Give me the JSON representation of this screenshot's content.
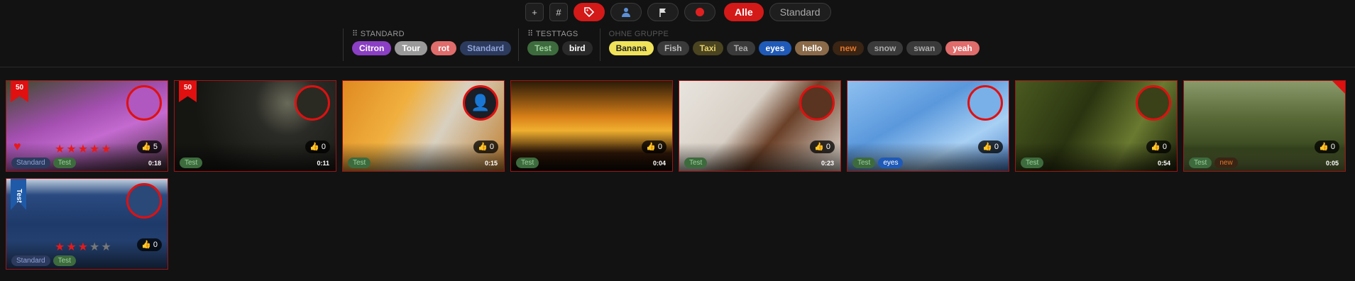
{
  "toolbar": {
    "buttons": [
      {
        "name": "add-button",
        "icon": "+"
      },
      {
        "name": "hash-button",
        "icon": "#"
      },
      {
        "name": "tag-button",
        "icon": "tag-icon",
        "active": true
      },
      {
        "name": "person-button",
        "icon": "person-icon"
      },
      {
        "name": "flag-button",
        "icon": "flag-icon"
      },
      {
        "name": "record-button",
        "icon": "record-icon"
      }
    ],
    "alle_label": "Alle",
    "standard_label": "Standard"
  },
  "filters": {
    "standard": {
      "title": "STANDARD",
      "chips": [
        {
          "label": "Citron",
          "bg": "#8b3fc4",
          "fg": "#fff"
        },
        {
          "label": "Tour",
          "bg": "#9a9a9a",
          "fg": "#fff"
        },
        {
          "label": "rot",
          "bg": "#e06c6c",
          "fg": "#fff"
        },
        {
          "label": "Standard",
          "bg": "#2c3a5e",
          "fg": "#8fa3d6"
        }
      ]
    },
    "testtags": {
      "title": "TESTTAGS",
      "chips": [
        {
          "label": "Test",
          "bg": "#3d6b3d",
          "fg": "#9ecf9e"
        },
        {
          "label": "bird",
          "bg": "#2a2a2a",
          "fg": "#fff"
        }
      ]
    },
    "ohne": {
      "title": "OHNE GRUPPE",
      "chips": [
        {
          "label": "Banana",
          "bg": "#f0e35a",
          "fg": "#222"
        },
        {
          "label": "Fish",
          "bg": "#3a3a3a",
          "fg": "#bbb"
        },
        {
          "label": "Taxi",
          "bg": "#4a4420",
          "fg": "#e8d36a"
        },
        {
          "label": "Tea",
          "bg": "#3a3a3a",
          "fg": "#aaa"
        },
        {
          "label": "eyes",
          "bg": "#1f5ab8",
          "fg": "#fff"
        },
        {
          "label": "hello",
          "bg": "#8a6a48",
          "fg": "#fff"
        },
        {
          "label": "new",
          "bg": "#3a2414",
          "fg": "#e0762a"
        },
        {
          "label": "snow",
          "bg": "#3a3a3a",
          "fg": "#aaa"
        },
        {
          "label": "swan",
          "bg": "#3a3a3a",
          "fg": "#aaa"
        },
        {
          "label": "yeah",
          "bg": "#e06c6c",
          "fg": "#fff"
        }
      ]
    }
  },
  "cards": [
    {
      "bg": "linear-gradient(160deg,#3d4a2a 0%,#a34fb0 40%,#c46ad0 60%,#3a2a30 100%)",
      "avatar": "flower",
      "avatar_bg": "#b157c0",
      "ribbon": "50",
      "heart": true,
      "stars": 5,
      "likes": "5",
      "duration": "0:18",
      "tags": [
        {
          "label": "Standard",
          "bg": "#2c3a5e",
          "fg": "#8fa3d6"
        },
        {
          "label": "Test",
          "bg": "#3d6b3d",
          "fg": "#9ecf9e"
        }
      ]
    },
    {
      "bg": "radial-gradient(circle at 70% 25%,#6a6a5a 0%,#2a2a26 25%,#151512 70%)",
      "avatar": "streetlamp",
      "avatar_bg": "#2a2a22",
      "ribbon": "50",
      "likes": "0",
      "duration": "0:11",
      "tags": [
        {
          "label": "Test",
          "bg": "#3d6b3d",
          "fg": "#9ecf9e"
        }
      ]
    },
    {
      "bg": "linear-gradient(120deg,#e08a20 0%,#f0b040 35%,#d8d0c0 60%,#c08030 100%)",
      "avatar": "person-icon",
      "avatar_bg": "#1a1e26",
      "likes": "0",
      "duration": "0:15",
      "tags": [
        {
          "label": "Test",
          "bg": "#3d6b3d",
          "fg": "#9ecf9e"
        }
      ]
    },
    {
      "bg": "linear-gradient(to bottom,#2a1a08 0%,#d88018 40%,#f0b030 55%,#301808 80%,#100804 100%)",
      "likes": "0",
      "duration": "0:04",
      "tags": [
        {
          "label": "Test",
          "bg": "#3d6b3d",
          "fg": "#9ecf9e"
        }
      ]
    },
    {
      "bg": "linear-gradient(130deg,#e8e4de 0%,#d8d0c6 40%,#6a4028 60%,#e6e0d8 100%)",
      "avatar": "coffee",
      "avatar_bg": "#5a3420",
      "likes": "0",
      "duration": "0:23",
      "tags": [
        {
          "label": "Test",
          "bg": "#3d6b3d",
          "fg": "#9ecf9e"
        }
      ]
    },
    {
      "bg": "linear-gradient(150deg,#8ec0f0 0%,#5a98dc 40%,#a8d0f4 70%,#4a80c8 100%)",
      "avatar": "ice",
      "avatar_bg": "#7ab0e8",
      "likes": "0",
      "duration": "",
      "tags": [
        {
          "label": "Test",
          "bg": "#3d6b3d",
          "fg": "#9ecf9e"
        },
        {
          "label": "eyes",
          "bg": "#1f5ab8",
          "fg": "#fff"
        }
      ]
    },
    {
      "bg": "linear-gradient(120deg,#4a5a20 0%,#2a3410 40%,#6a7a30 70%,#1a200a 100%)",
      "avatar": "bird",
      "avatar_bg": "#3a4018",
      "likes": "0",
      "duration": "0:54",
      "tags": [
        {
          "label": "Test",
          "bg": "#3d6b3d",
          "fg": "#9ecf9e"
        }
      ]
    },
    {
      "bg": "linear-gradient(to bottom,#8a9a6a 0%,#5a6a38 40%,#3a4a20 75%,#6a7a40 100%)",
      "corner": true,
      "likes": "0",
      "duration": "0:05",
      "tags": [
        {
          "label": "Test",
          "bg": "#3d6b3d",
          "fg": "#9ecf9e"
        },
        {
          "label": "new",
          "bg": "#3a2414",
          "fg": "#e0762a"
        }
      ]
    },
    {
      "bg": "linear-gradient(to bottom,#c0d0e0 0%,#2a4a80 18%,#1e3a6a 50%,#2a4878 100%)",
      "avatar": "swan",
      "avatar_bg": "#2a4878",
      "ribbon_blue": "Test",
      "stars": 3,
      "likes": "0",
      "duration": "",
      "tags": [
        {
          "label": "Standard",
          "bg": "#2c3a5e",
          "fg": "#8fa3d6"
        },
        {
          "label": "Test",
          "bg": "#3d6b3d",
          "fg": "#9ecf9e"
        }
      ]
    }
  ]
}
